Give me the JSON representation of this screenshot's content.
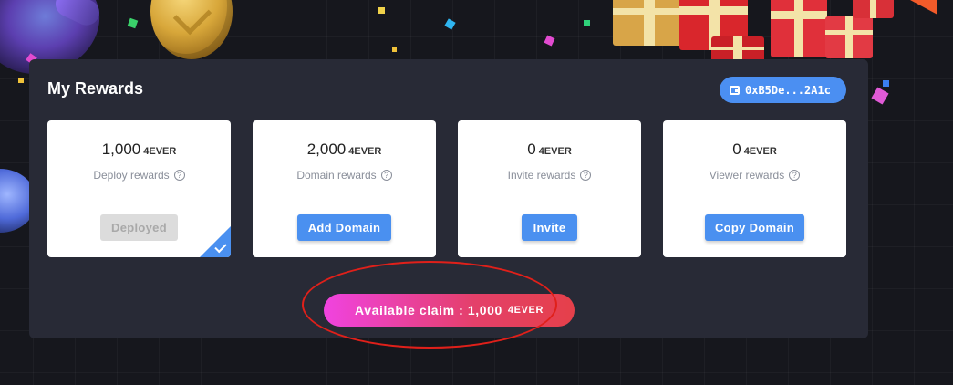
{
  "panel": {
    "title": "My Rewards",
    "wallet_address": "0xB5De...2A1c"
  },
  "cards": [
    {
      "amount": "1,000",
      "unit": "4EVER",
      "label": "Deploy rewards",
      "button": "Deployed",
      "completed": true
    },
    {
      "amount": "2,000",
      "unit": "4EVER",
      "label": "Domain rewards",
      "button": "Add Domain",
      "completed": false
    },
    {
      "amount": "0",
      "unit": "4EVER",
      "label": "Invite rewards",
      "button": "Invite",
      "completed": false
    },
    {
      "amount": "0",
      "unit": "4EVER",
      "label": "Viewer rewards",
      "button": "Copy Domain",
      "completed": false
    }
  ],
  "claim": {
    "label": "Available claim : 1,000",
    "unit": "4EVER"
  },
  "help_glyph": "?",
  "colors": {
    "accent": "#4a90f0",
    "panel_bg": "#282a36",
    "claim_gradient_start": "#f043e0",
    "claim_gradient_end": "#e5404a",
    "annotation": "#e0201a"
  },
  "icons": [
    "wallet-icon",
    "help-icon",
    "checkmark-icon"
  ]
}
